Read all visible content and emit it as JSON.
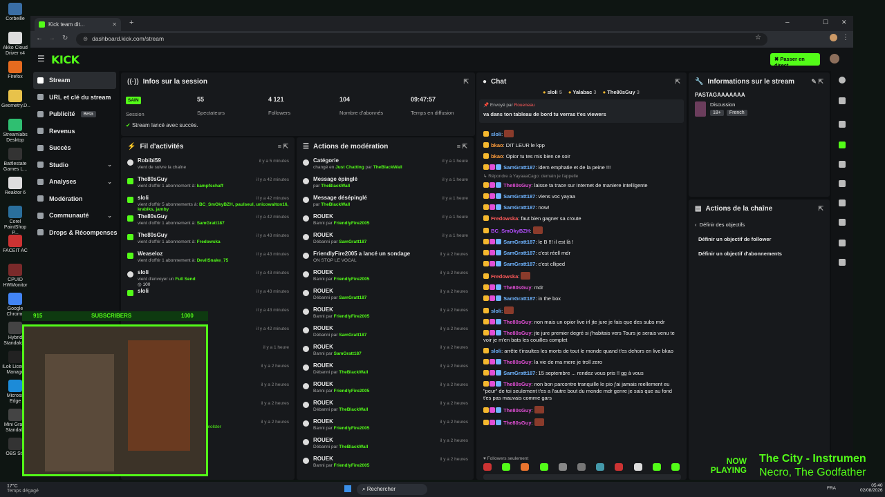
{
  "desktop": {
    "icons": [
      "Corbeille",
      "Akko Cloud Driver v4",
      "Firefox",
      "Geometry.D...",
      "Streamlabs Desktop",
      "Battlestate Games L...",
      "Reaktor 6",
      "Corel PaintShop P...",
      "FACEIT AC",
      "CPUID HWMonitor",
      "Google Chrome",
      "Hybrid Standalo...",
      "iLok Licen... Manage",
      "Microso Edge",
      "Mini Gra... Standalo",
      "OBS Stu"
    ]
  },
  "browser": {
    "tab_title": "Kick team dit...",
    "new_tab": "+",
    "url": "dashboard.kick.com/stream",
    "window_controls": [
      "–",
      "☐",
      "✕"
    ]
  },
  "app": {
    "logo": "KICK",
    "go_live": "Passer en direct",
    "sidebar": [
      {
        "label": "Stream",
        "icon": "stream-icon",
        "active": true
      },
      {
        "label": "URL et clé du stream",
        "icon": "key-icon"
      },
      {
        "label": "Publicité",
        "icon": "ad-icon",
        "badge": "Beta"
      },
      {
        "label": "Revenus",
        "icon": "money-icon"
      },
      {
        "label": "Succès",
        "icon": "trophy-icon"
      },
      {
        "label": "Studio",
        "icon": "studio-icon",
        "chevron": "⌄"
      },
      {
        "label": "Analyses",
        "icon": "chart-icon",
        "chevron": "⌄"
      },
      {
        "label": "Modération",
        "icon": "shield-icon"
      },
      {
        "label": "Communauté",
        "icon": "users-icon",
        "chevron": "⌄"
      },
      {
        "label": "Drops & Récompenses",
        "icon": "gift-icon"
      }
    ],
    "session": {
      "title": "Infos sur la session",
      "status": "SAIN",
      "status_label": "Session",
      "stats": [
        {
          "value": "55",
          "label": "Spectateurs"
        },
        {
          "value": "4 121",
          "label": "Followers"
        },
        {
          "value": "104",
          "label": "Nombre d'abonnés"
        },
        {
          "value": "09:47:57",
          "label": "Temps en diffusion"
        }
      ],
      "success_msg": "Stream lancé avec succès."
    },
    "feed": {
      "title": "Fil d'activités",
      "rows": [
        {
          "name": "Robibi59",
          "sub": "vient de suivre la chaîne",
          "time": "il y a 5 minutes",
          "type": "heart"
        },
        {
          "name": "The80sGuy",
          "sub": "vient d'offrir 1 abonnement à: ",
          "hl": "kampfschaff",
          "time": "il y a 42 minutes",
          "type": "gift"
        },
        {
          "name": "sloli",
          "sub": "vient d'offrir 5 abonnements à: ",
          "hl": "BC_SmOkyBZH, paulseul, unicowalton16, krabiks, jamby",
          "time": "il y a 42 minutes",
          "type": "gift"
        },
        {
          "name": "The80sGuy",
          "sub": "vient d'offrir 1 abonnement à: ",
          "hl": "SamGratt187",
          "time": "il y a 42 minutes",
          "type": "gift"
        },
        {
          "name": "The80sGuy",
          "sub": "vient d'offrir 1 abonnement à: ",
          "hl": "Fredowska",
          "time": "il y a 43 minutes",
          "type": "gift"
        },
        {
          "name": "Weaseloz",
          "sub": "vient d'offrir 1 abonnement à: ",
          "hl": "DevilSnake_75",
          "time": "il y a 43 minutes",
          "type": "gift"
        },
        {
          "name": "sloli",
          "sub": "vient d'envoyer un ",
          "hl": "Full Send",
          "extra": "100",
          "time": "il y a 43 minutes",
          "type": "kick"
        },
        {
          "name": "sloli",
          "sub": "",
          "hl": "",
          "time": "il y a 43 minutes",
          "type": "gift"
        }
      ],
      "hidden_times": [
        "il y a 43 minutes",
        "il y a 42 minutes",
        "il y a 1 heure",
        "il y a 2 heures",
        "il y a 2 heures",
        "il y a 2 heures",
        "il y a 2 heures"
      ],
      "partial_name": "omolster"
    },
    "modactions": {
      "title": "Actions de modération",
      "rows": [
        {
          "name": "Catégorie",
          "sub": "changé en ",
          "hl": "Just Chatting",
          "sub2": " par ",
          "hl2": "TheBlackWall",
          "time": "il y a 1 heure"
        },
        {
          "name": "Message épinglé",
          "sub": "par ",
          "hl": "TheBlackWall",
          "time": "il y a 1 heure"
        },
        {
          "name": "Message désépinglé",
          "sub": "par ",
          "hl": "TheBlackWall",
          "time": "il y a 1 heure"
        },
        {
          "name": "ROUEK",
          "sub": "Banni par ",
          "hl": "FriendlyFire2005",
          "time": "il y a 1 heure"
        },
        {
          "name": "ROUEK",
          "sub": "Débanni par ",
          "hl": "SamGratt187",
          "time": "il y a 1 heure"
        },
        {
          "name": "FriendlyFire2005 a lancé un sondage",
          "sub": "ON STOP LE VOCAL",
          "hl": "",
          "time": "il y a 2 heures"
        },
        {
          "name": "ROUEK",
          "sub": "Banni par ",
          "hl": "FriendlyFire2005",
          "time": "il y a 2 heures"
        },
        {
          "name": "ROUEK",
          "sub": "Débanni par ",
          "hl": "SamGratt187",
          "time": "il y a 2 heures"
        },
        {
          "name": "ROUEK",
          "sub": "Banni par ",
          "hl": "FriendlyFire2005",
          "time": "il y a 2 heures"
        },
        {
          "name": "ROUEK",
          "sub": "Débanni par ",
          "hl": "SamGratt187",
          "time": "il y a 2 heures"
        },
        {
          "name": "ROUEK",
          "sub": "Banni par ",
          "hl": "SamGratt187",
          "time": "il y a 2 heures"
        },
        {
          "name": "ROUEK",
          "sub": "Débanni par ",
          "hl": "TheBlackWall",
          "time": "il y a 2 heures"
        },
        {
          "name": "ROUEK",
          "sub": "Banni par ",
          "hl": "FriendlyFire2005",
          "time": "il y a 2 heures"
        },
        {
          "name": "ROUEK",
          "sub": "Débanni par ",
          "hl": "TheBlackWall",
          "time": "il y a 2 heures"
        },
        {
          "name": "ROUEK",
          "sub": "Banni par ",
          "hl": "FriendlyFire2005",
          "time": "il y a 2 heures"
        },
        {
          "name": "ROUEK",
          "sub": "Débanni par ",
          "hl": "TheBlackWall",
          "time": "il y a 2 heures"
        },
        {
          "name": "ROUEK",
          "sub": "Banni par ",
          "hl": "FriendlyFire2005",
          "time": "il y a 2 heures"
        }
      ]
    },
    "chat": {
      "title": "Chat",
      "top_gifters": [
        {
          "name": "sloli",
          "count": "5"
        },
        {
          "name": "Yalabac",
          "count": "3"
        },
        {
          "name": "The80sGuy",
          "count": "3"
        }
      ],
      "pinned_by": "Envoyé par",
      "pinned_user": "Roueneau",
      "pinned_text": "va dans ton tableau de bord tu verras t'es viewers",
      "messages": [
        {
          "user": "sloli",
          "color": "#6fb4ff",
          "text": "",
          "sticker": true
        },
        {
          "user": "bkao",
          "color": "#ff9d3b",
          "text": "DIT LEUR le kpp"
        },
        {
          "user": "bkao",
          "color": "#ff9d3b",
          "text": "Opior tu tes mis bien ce soir"
        },
        {
          "user": "SamGratt187",
          "color": "#6fb4ff",
          "text": "idem emphatie et de la peine !!!",
          "badges": 3
        },
        {
          "reply": "Répondre à YayaaaCago: demain je l'appelle"
        },
        {
          "user": "The80sGuy",
          "color": "#e24fd6",
          "text": "laisse ta trace sur Internet de maniere intelligente",
          "badges": 3
        },
        {
          "user": "SamGratt187",
          "color": "#6fb4ff",
          "text": "viens voc yayaa",
          "badges": 3
        },
        {
          "user": "SamGratt187",
          "color": "#6fb4ff",
          "text": "now!",
          "badges": 3
        },
        {
          "user": "Fredowska",
          "color": "#ff5a5a",
          "text": "faut bien gagner sa croute"
        },
        {
          "user": "BC_SmOkyBZH",
          "color": "#b44fff",
          "text": "",
          "sticker": true
        },
        {
          "user": "SamGratt187",
          "color": "#6fb4ff",
          "text": "le B !!! il est là !",
          "badges": 3
        },
        {
          "user": "SamGratt187",
          "color": "#6fb4ff",
          "text": "c'est réell mdr",
          "badges": 3
        },
        {
          "user": "SamGratt187",
          "color": "#6fb4ff",
          "text": "c'est clliped",
          "badges": 3
        },
        {
          "user": "Fredowska",
          "color": "#ff5a5a",
          "text": "",
          "sticker": true
        },
        {
          "user": "The80sGuy",
          "color": "#e24fd6",
          "text": "mdr",
          "badges": 3
        },
        {
          "user": "SamGratt187",
          "color": "#6fb4ff",
          "text": "in the box",
          "badges": 3
        },
        {
          "user": "sloli",
          "color": "#6fb4ff",
          "text": "",
          "sticker": true
        },
        {
          "user": "The80sGuy",
          "color": "#e24fd6",
          "text": "non mais un opior live irl jte jure je fais que des subs mdr",
          "badges": 3
        },
        {
          "user": "The80sGuy",
          "color": "#e24fd6",
          "text": "jte jure premier degré si j'habitais vers Tours je serais venu te voir je m'en bats les couilles complet",
          "badges": 3
        },
        {
          "user": "sloli",
          "color": "#6fb4ff",
          "text": "arrête t'insultes les morts de tout le monde quand t'es dehors en live bkao"
        },
        {
          "user": "The80sGuy",
          "color": "#e24fd6",
          "text": "la vie de ma mere je troll zero",
          "badges": 3
        },
        {
          "user": "SamGratt187",
          "color": "#6fb4ff",
          "text": "15 septembre ... rendez vous pris !! gg à vous",
          "badges": 3
        },
        {
          "user": "The80sGuy",
          "color": "#e24fd6",
          "text": "non bon parcontre tranquille le pio j'ai jamais reellement eu \"peur\" de toi seulement t'es a l'autre bout du monde mdr genre je sais que au fond t'es pas mauvais comme gars",
          "badges": 3
        },
        {
          "user": "The80sGuy",
          "color": "#e24fd6",
          "text": "",
          "sticker": true,
          "badges": 3
        },
        {
          "user": "The80sGuy",
          "color": "#e24fd6",
          "text": "",
          "sticker": true,
          "badges": 3
        }
      ],
      "followers_only": "Followers seulement",
      "input_placeholder": ""
    },
    "info": {
      "title": "Informations sur le stream",
      "stream_title": "PASTAGAAAAAAA",
      "category": "Discussion",
      "tags": [
        "18+",
        "French"
      ]
    },
    "channel_actions": {
      "title": "Actions de la chaîne",
      "back_label": "Définir des objectifs",
      "items": [
        "Définir un objectif de follower",
        "Définir un objectif d'abonnements"
      ]
    }
  },
  "overlay": {
    "sub_left": "915",
    "sub_label": "SUBSCRIBERS",
    "sub_right": "1000",
    "now_playing": "NOW\nPLAYING",
    "song": "The City - Instrumen",
    "artist": "Necro, The Godfather"
  },
  "taskbar": {
    "weather": "17°C",
    "weather_sub": "Temps dégagé",
    "search": "Rechercher",
    "lang": "FRA",
    "time": "05:40",
    "date": "02/08/2026"
  }
}
